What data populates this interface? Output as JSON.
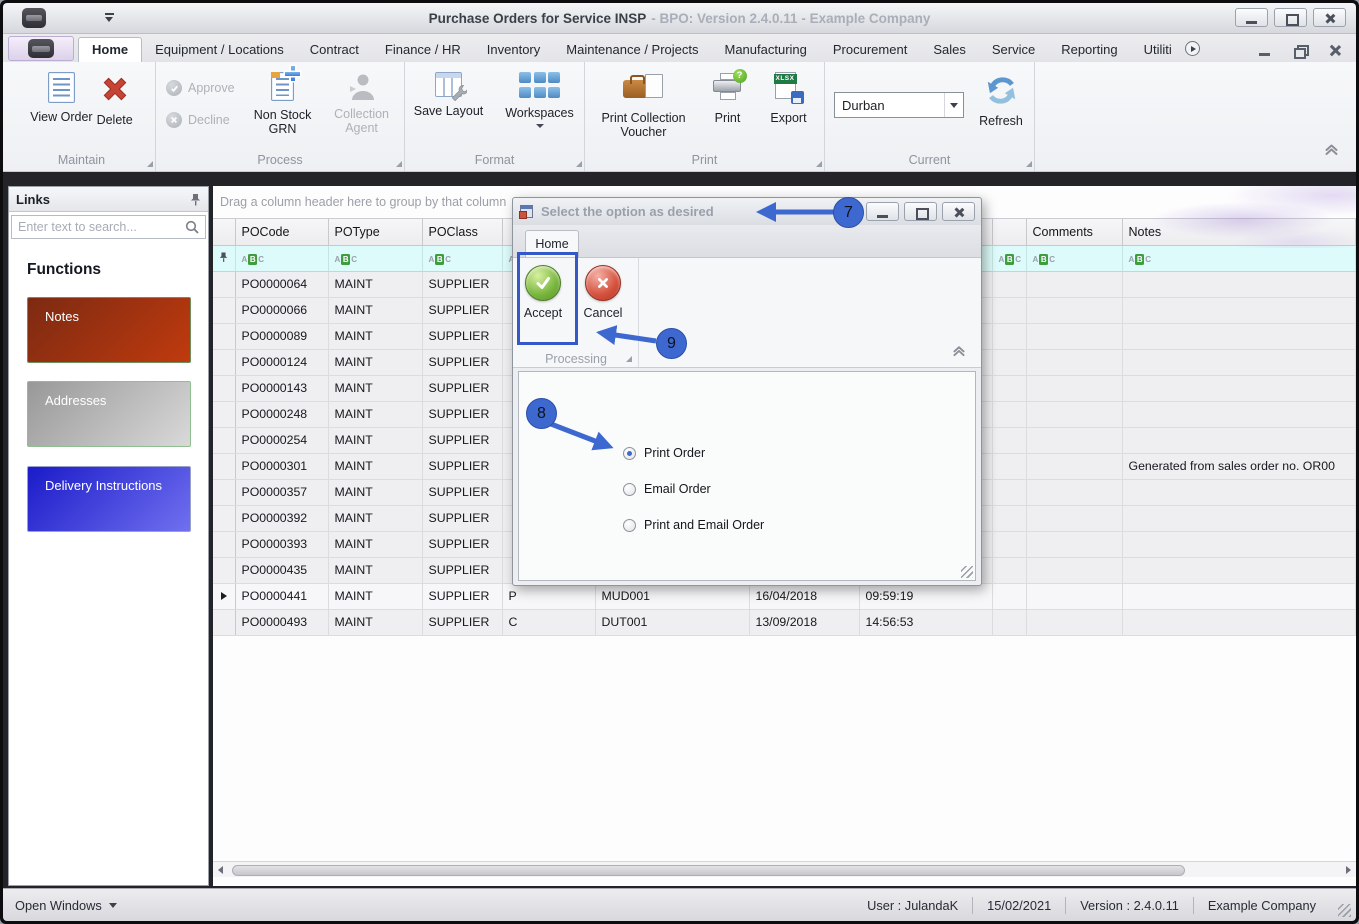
{
  "titlebar": {
    "title_main": "Purchase Orders for Service INSP",
    "title_rest": "- BPO: Version 2.4.0.11 - Example Company"
  },
  "ribbon": {
    "tabs": [
      "Home",
      "Equipment / Locations",
      "Contract",
      "Finance / HR",
      "Inventory",
      "Maintenance / Projects",
      "Manufacturing",
      "Procurement",
      "Sales",
      "Service",
      "Reporting",
      "Utiliti"
    ],
    "selected_tab": "Home",
    "groups": {
      "maintain": {
        "label": "Maintain",
        "view_order": "View Order",
        "delete": "Delete"
      },
      "process": {
        "label": "Process",
        "approve": "Approve",
        "decline": "Decline",
        "non_stock_grn": "Non Stock\nGRN",
        "collection_agent": "Collection\nAgent"
      },
      "format": {
        "label": "Format",
        "save_layout": "Save Layout",
        "workspaces": "Workspaces"
      },
      "print": {
        "label": "Print",
        "print_collection_voucher": "Print Collection\nVoucher",
        "print": "Print",
        "export": "Export"
      },
      "current": {
        "label": "Current",
        "site_value": "Durban",
        "refresh": "Refresh"
      }
    }
  },
  "icons": {
    "export_badge": "XLSX",
    "print_badge": "?",
    "filter_a": "A",
    "filter_b": "B",
    "filter_c": "C"
  },
  "sidebar": {
    "header": "Links",
    "search_placeholder": "Enter text to search...",
    "section_title": "Functions",
    "buttons": [
      "Notes",
      "Addresses",
      "Delivery Instructions"
    ]
  },
  "grid": {
    "group_hint": "Drag a column header here to group by that column",
    "columns": [
      "POCode",
      "POType",
      "POClass",
      "",
      "",
      "",
      "",
      "",
      "Comments",
      "Notes"
    ],
    "current_row_index": 12,
    "rows": [
      [
        "PO0000064",
        "MAINT",
        "SUPPLIER",
        "",
        "",
        "",
        "",
        "",
        "",
        ""
      ],
      [
        "PO0000066",
        "MAINT",
        "SUPPLIER",
        "",
        "",
        "",
        "",
        "",
        "",
        ""
      ],
      [
        "PO0000089",
        "MAINT",
        "SUPPLIER",
        "",
        "",
        "",
        "",
        "",
        "",
        ""
      ],
      [
        "PO0000124",
        "MAINT",
        "SUPPLIER",
        "",
        "",
        "",
        "",
        "",
        "",
        ""
      ],
      [
        "PO0000143",
        "MAINT",
        "SUPPLIER",
        "",
        "",
        "",
        "",
        "",
        "",
        ""
      ],
      [
        "PO0000248",
        "MAINT",
        "SUPPLIER",
        "",
        "",
        "",
        "",
        "",
        "",
        ""
      ],
      [
        "PO0000254",
        "MAINT",
        "SUPPLIER",
        "",
        "",
        "",
        "",
        "",
        "",
        ""
      ],
      [
        "PO0000301",
        "MAINT",
        "SUPPLIER",
        "",
        "",
        "",
        "",
        "",
        "",
        "Generated from sales order no. OR00"
      ],
      [
        "PO0000357",
        "MAINT",
        "SUPPLIER",
        "",
        "",
        "",
        "",
        "",
        "",
        ""
      ],
      [
        "PO0000392",
        "MAINT",
        "SUPPLIER",
        "",
        "",
        "",
        "",
        "",
        "",
        ""
      ],
      [
        "PO0000393",
        "MAINT",
        "SUPPLIER",
        "",
        "",
        "",
        "",
        "",
        "",
        ""
      ],
      [
        "PO0000435",
        "MAINT",
        "SUPPLIER",
        "",
        "",
        "",
        "",
        "",
        "",
        ""
      ],
      [
        "PO0000441",
        "MAINT",
        "SUPPLIER",
        "P",
        "MUD001",
        "16/04/2018",
        "09:59:19",
        "",
        "",
        ""
      ],
      [
        "PO0000493",
        "MAINT",
        "SUPPLIER",
        "C",
        "DUT001",
        "13/09/2018",
        "14:56:53",
        "",
        "",
        ""
      ]
    ]
  },
  "dialog": {
    "title": "Select the option as desired",
    "tab": "Home",
    "accept": "Accept",
    "cancel": "Cancel",
    "group_label": "Processing",
    "options": [
      {
        "label": "Print Order",
        "selected": true
      },
      {
        "label": "Email Order",
        "selected": false
      },
      {
        "label": "Print and Email Order",
        "selected": false
      }
    ]
  },
  "annotations": {
    "n7": "7",
    "n8": "8",
    "n9": "9"
  },
  "statusbar": {
    "open_windows": "Open Windows",
    "user": "User : JulandaK",
    "date": "15/02/2021",
    "version": "Version : 2.4.0.11",
    "company": "Example Company"
  },
  "colors": {
    "annotation_blue": "#3c68cf",
    "filter_row_bg": "#ddfbfa",
    "notes_gradient": [
      "#7c2a12",
      "#c03a0e"
    ],
    "addresses_gradient": [
      "#989898",
      "#d9d9d9"
    ],
    "delivery_gradient": [
      "#1b1bc9",
      "#7070f0"
    ],
    "accept_green": "#77b53c",
    "cancel_red": "#d4503c"
  }
}
